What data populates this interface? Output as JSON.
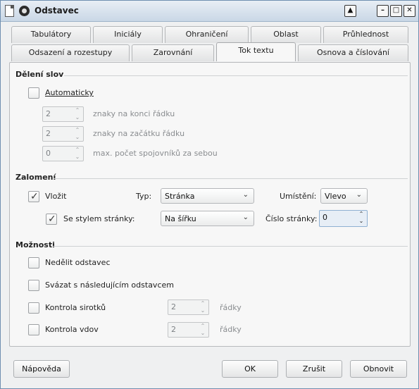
{
  "window": {
    "title": "Odstavec"
  },
  "tabs_row1": [
    {
      "label": "Tabulátory"
    },
    {
      "label": "Iniciály"
    },
    {
      "label": "Ohraničení"
    },
    {
      "label": "Oblast"
    },
    {
      "label": "Průhlednost"
    }
  ],
  "tabs_row2": [
    {
      "label": "Odsazení a rozestupy"
    },
    {
      "label": "Zarovnání"
    },
    {
      "label": "Tok textu",
      "active": true
    },
    {
      "label": "Osnova a číslování"
    }
  ],
  "hyphenation": {
    "title": "Dělení slov",
    "automatic_label": "Automaticky",
    "automatic_checked": false,
    "end_chars": {
      "value": "2",
      "label": "znaky na konci řádku"
    },
    "start_chars": {
      "value": "2",
      "label": "znaky na začátku řádku"
    },
    "max_hyphens": {
      "value": "0",
      "label": "max. počet spojovníků za sebou"
    }
  },
  "breaks": {
    "title": "Zalomení",
    "insert_label": "Vložit",
    "insert_checked": true,
    "type_label": "Typ:",
    "type_value": "Stránka",
    "position_label": "Umístění:",
    "position_value": "Vlevo",
    "page_style_label": "Se stylem stránky:",
    "page_style_checked": true,
    "page_style_value": "Na šířku",
    "page_number_label": "Číslo stránky:",
    "page_number_value": "0"
  },
  "options": {
    "title": "Možnosti",
    "no_split_label": "Nedělit odstavec",
    "keep_next_label": "Svázat s následujícím odstavcem",
    "orphan_label": "Kontrola sirotků",
    "orphan_value": "2",
    "orphan_unit": "řádky",
    "widow_label": "Kontrola vdov",
    "widow_value": "2",
    "widow_unit": "řádky"
  },
  "buttons": {
    "help": "Nápověda",
    "ok": "OK",
    "cancel": "Zrušit",
    "reset": "Obnovit"
  }
}
